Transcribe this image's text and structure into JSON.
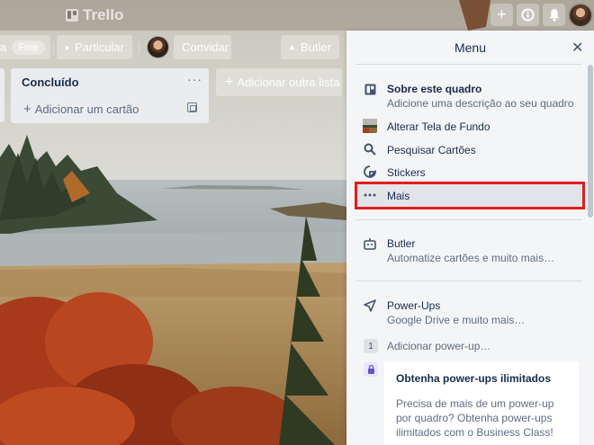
{
  "header": {
    "logo_text": "Trello",
    "add_icon": "plus-icon",
    "info_icon": "info-icon",
    "notifications_icon": "bell-icon"
  },
  "board_bar": {
    "board_suffix": "a",
    "plan_badge": "Free",
    "visibility_label": "Particular",
    "invite_label": "Convidar",
    "butler_label": "Butler"
  },
  "list": {
    "title": "Concluído",
    "menu_glyph": "···",
    "add_card_label": "Adicionar um cartão"
  },
  "add_list_label": "Adicionar outra lista",
  "menu": {
    "title": "Menu",
    "close_glyph": "✕",
    "items": [
      {
        "title": "Sobre este quadro",
        "subtitle": "Adicione uma descrição ao seu quadro",
        "icon": "board-icon"
      },
      {
        "title": "Alterar Tela de Fundo",
        "icon": "background-thumbnail"
      },
      {
        "title": "Pesquisar Cartões",
        "icon": "search-icon"
      },
      {
        "title": "Stickers",
        "icon": "sticker-icon"
      },
      {
        "title": "Mais",
        "icon": "more-icon"
      }
    ],
    "butler": {
      "title": "Butler",
      "subtitle": "Automatize cartões e muito mais…",
      "icon": "butler-icon"
    },
    "powerups": {
      "title": "Power-Ups",
      "subtitle": "Google Drive e muito mais…",
      "icon": "rocket-icon"
    },
    "add_powerup": {
      "count": "1",
      "label": "Adicionar power-up…"
    },
    "promo": {
      "title": "Obtenha power-ups ilimitados",
      "text": "Precisa de mais de um power-up por quadro? Obtenha power-ups ilimitados com o Business Class!"
    }
  },
  "colors": {
    "highlight_border": "#e01e1e",
    "menu_bg": "#f4f5f7",
    "list_bg": "#ebecf0"
  }
}
